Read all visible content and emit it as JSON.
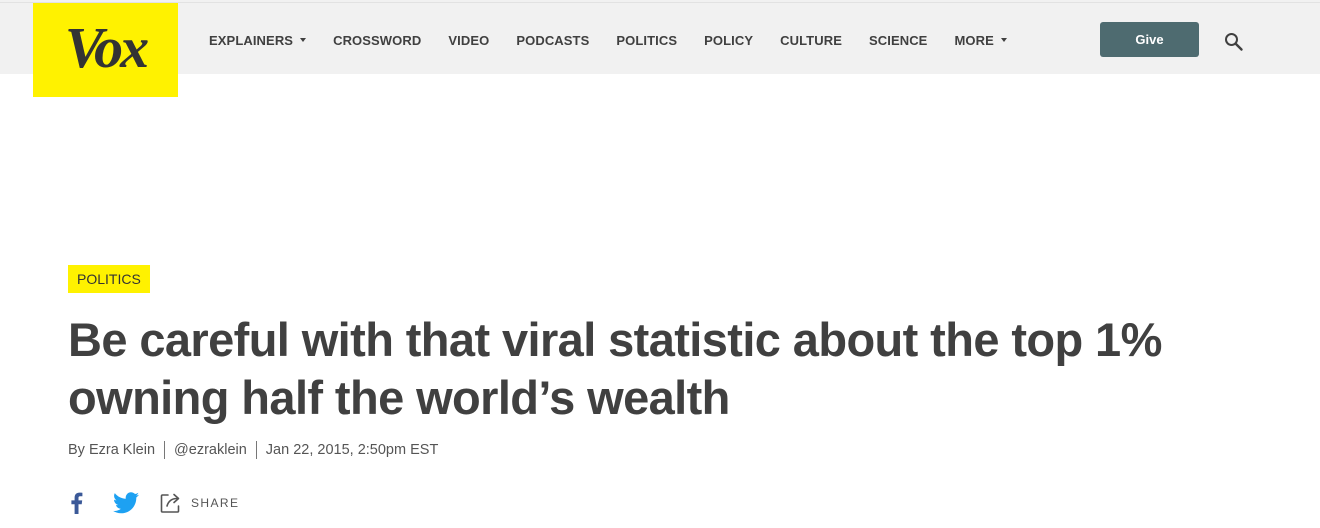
{
  "brand": {
    "logo_text": "Vox"
  },
  "nav": {
    "items": [
      {
        "label": "EXPLAINERS",
        "has_dropdown": true
      },
      {
        "label": "CROSSWORD",
        "has_dropdown": false
      },
      {
        "label": "VIDEO",
        "has_dropdown": false
      },
      {
        "label": "PODCASTS",
        "has_dropdown": false
      },
      {
        "label": "POLITICS",
        "has_dropdown": false
      },
      {
        "label": "POLICY",
        "has_dropdown": false
      },
      {
        "label": "CULTURE",
        "has_dropdown": false
      },
      {
        "label": "SCIENCE",
        "has_dropdown": false
      },
      {
        "label": "MORE",
        "has_dropdown": true
      }
    ],
    "give_label": "Give",
    "search_icon": "search-icon"
  },
  "article": {
    "category": "POLITICS",
    "headline": "Be careful with that viral statistic about the top 1% owning half the world’s wealth",
    "byline": {
      "author": "By Ezra Klein",
      "handle": "@ezraklein",
      "date": "Jan 22, 2015, 2:50pm EST"
    },
    "share": {
      "facebook_icon": "facebook-icon",
      "twitter_icon": "twitter-icon",
      "share_label": "SHARE"
    }
  },
  "colors": {
    "brand_yellow": "#fff200",
    "topbar_bg": "#f1f1f1",
    "give_button": "#4e6b70",
    "text": "#404040",
    "facebook": "#3b5998",
    "twitter": "#1da1f2"
  }
}
